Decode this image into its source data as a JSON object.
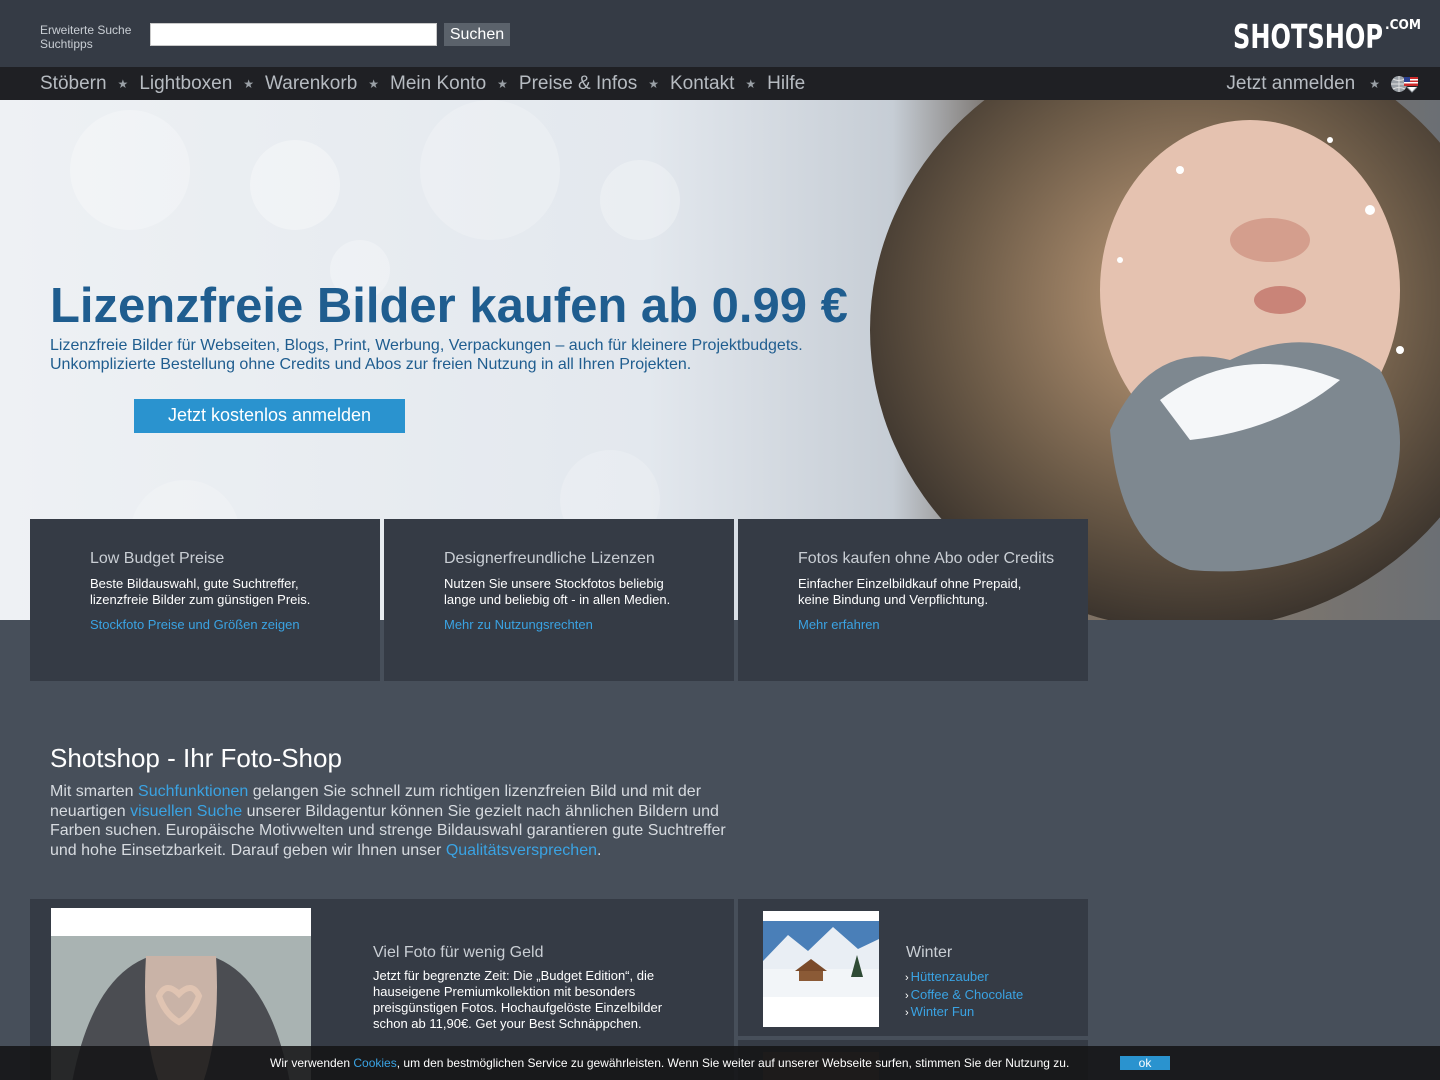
{
  "header": {
    "advanced_search": "Erweiterte Suche",
    "search_tips": "Suchtipps",
    "search_value": "",
    "search_button": "Suchen",
    "logo_text": "SHOTSHOP",
    "logo_suffix": ".COM"
  },
  "nav": {
    "items": [
      "Stöbern",
      "Lightboxen",
      "Warenkorb",
      "Mein Konto",
      "Preise & Infos",
      "Kontakt",
      "Hilfe"
    ],
    "separator": "★",
    "login": "Jetzt anmelden",
    "language_icon": "globe-flag-icon"
  },
  "hero": {
    "title": "Lizenzfreie Bilder kaufen ab 0.99 €",
    "subtitle_line1": "Lizenzfreie Bilder für Webseiten, Blogs, Print, Werbung, Verpackungen – auch für kleinere Projektbudgets.",
    "subtitle_line2": "Unkomplizierte Bestellung ohne Credits und Abos zur freien Nutzung in all Ihren Projekten.",
    "cta": "Jetzt kostenlos anmelden"
  },
  "features": [
    {
      "title": "Low Budget Preise",
      "line1": "Beste Bildauswahl, gute Suchtreffer,",
      "line2": "lizenzfreie Bilder zum günstigen Preis.",
      "link": "Stockfoto Preise und Größen zeigen"
    },
    {
      "title": "Designerfreundliche Lizenzen",
      "line1": "Nutzen Sie unsere Stockfotos beliebig",
      "line2": "lange und beliebig oft - in allen Medien.",
      "link": "Mehr zu Nutzungsrechten"
    },
    {
      "title": "Fotos kaufen ohne Abo oder Credits",
      "line1": "Einfacher Einzelbildkauf ohne Prepaid,",
      "line2": "keine Bindung und Verpflichtung.",
      "link": "Mehr erfahren"
    }
  ],
  "intro": {
    "title": "Shotshop - Ihr Foto-Shop",
    "t1": "Mit smarten ",
    "l1": "Suchfunktionen",
    "t2": " gelangen Sie schnell zum richtigen lizenzfreien Bild und mit der neuartigen ",
    "l2": "visuellen Suche",
    "t3": " unserer Bildagentur können Sie gezielt nach ähnlichen Bildern und Farben suchen. Europäische Motivwelten und strenge Bildauswahl garantieren gute Suchtreffer und hohe Einsetzbarkeit. Darauf geben wir Ihnen unser ",
    "l3": "Qualitätsversprechen",
    "t4": "."
  },
  "promo": {
    "title": "Viel Foto für wenig Geld",
    "lines": [
      "Jetzt für begrenzte Zeit: Die „Budget Edition“, die",
      "hauseigene Premiumkollektion mit besonders",
      "preisgünstigen Fotos. Hochaufgelöste Einzelbilder",
      "schon ab 11,90€. Get your Best Schnäppchen."
    ]
  },
  "winter": {
    "title": "Winter",
    "links": [
      "Hüttenzauber",
      "Coffee & Chocolate",
      "Winter Fun"
    ]
  },
  "cookie": {
    "t1": "Wir verwenden ",
    "link": "Cookies",
    "t2": ", um den bestmöglichen Service zu gewährleisten. Wenn Sie weiter auf unserer Webseite surfen, stimmen Sie der Nutzung zu.",
    "ok": "ok"
  },
  "colors": {
    "accent": "#2a93cf",
    "link": "#3aa3e3",
    "hero_text": "#1f5d8f",
    "panel": "#353b45",
    "background": "#474f5a"
  }
}
